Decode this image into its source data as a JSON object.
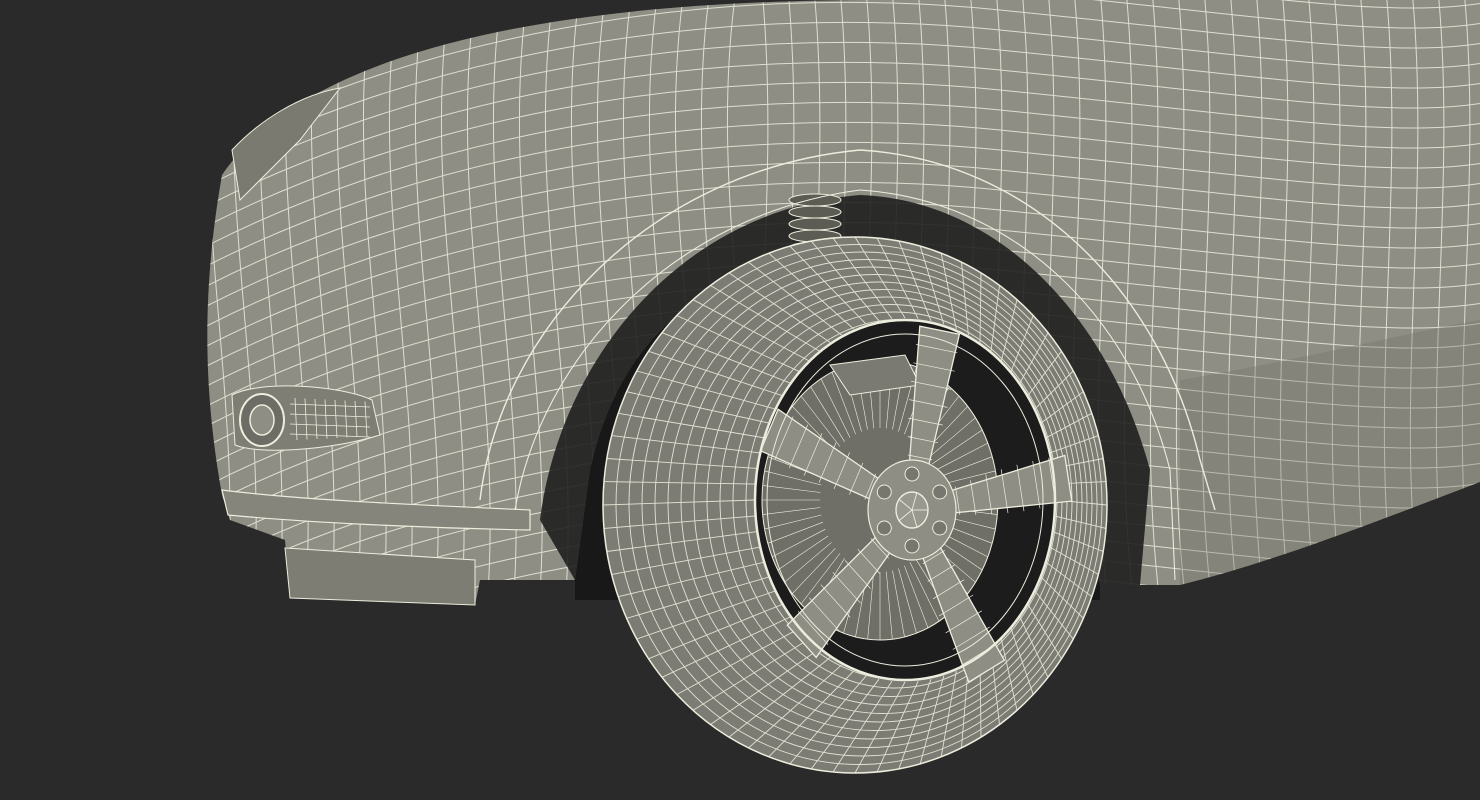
{
  "scene": {
    "subject": "car-front-wheel-wireframe",
    "background_color": "#2a2a2a",
    "body_color": "#8e8e84",
    "body_shade_color": "#6e6e66",
    "wheel_well_color": "#181818",
    "wire_color": "#ededde",
    "tire_color": "#7c7c74"
  }
}
